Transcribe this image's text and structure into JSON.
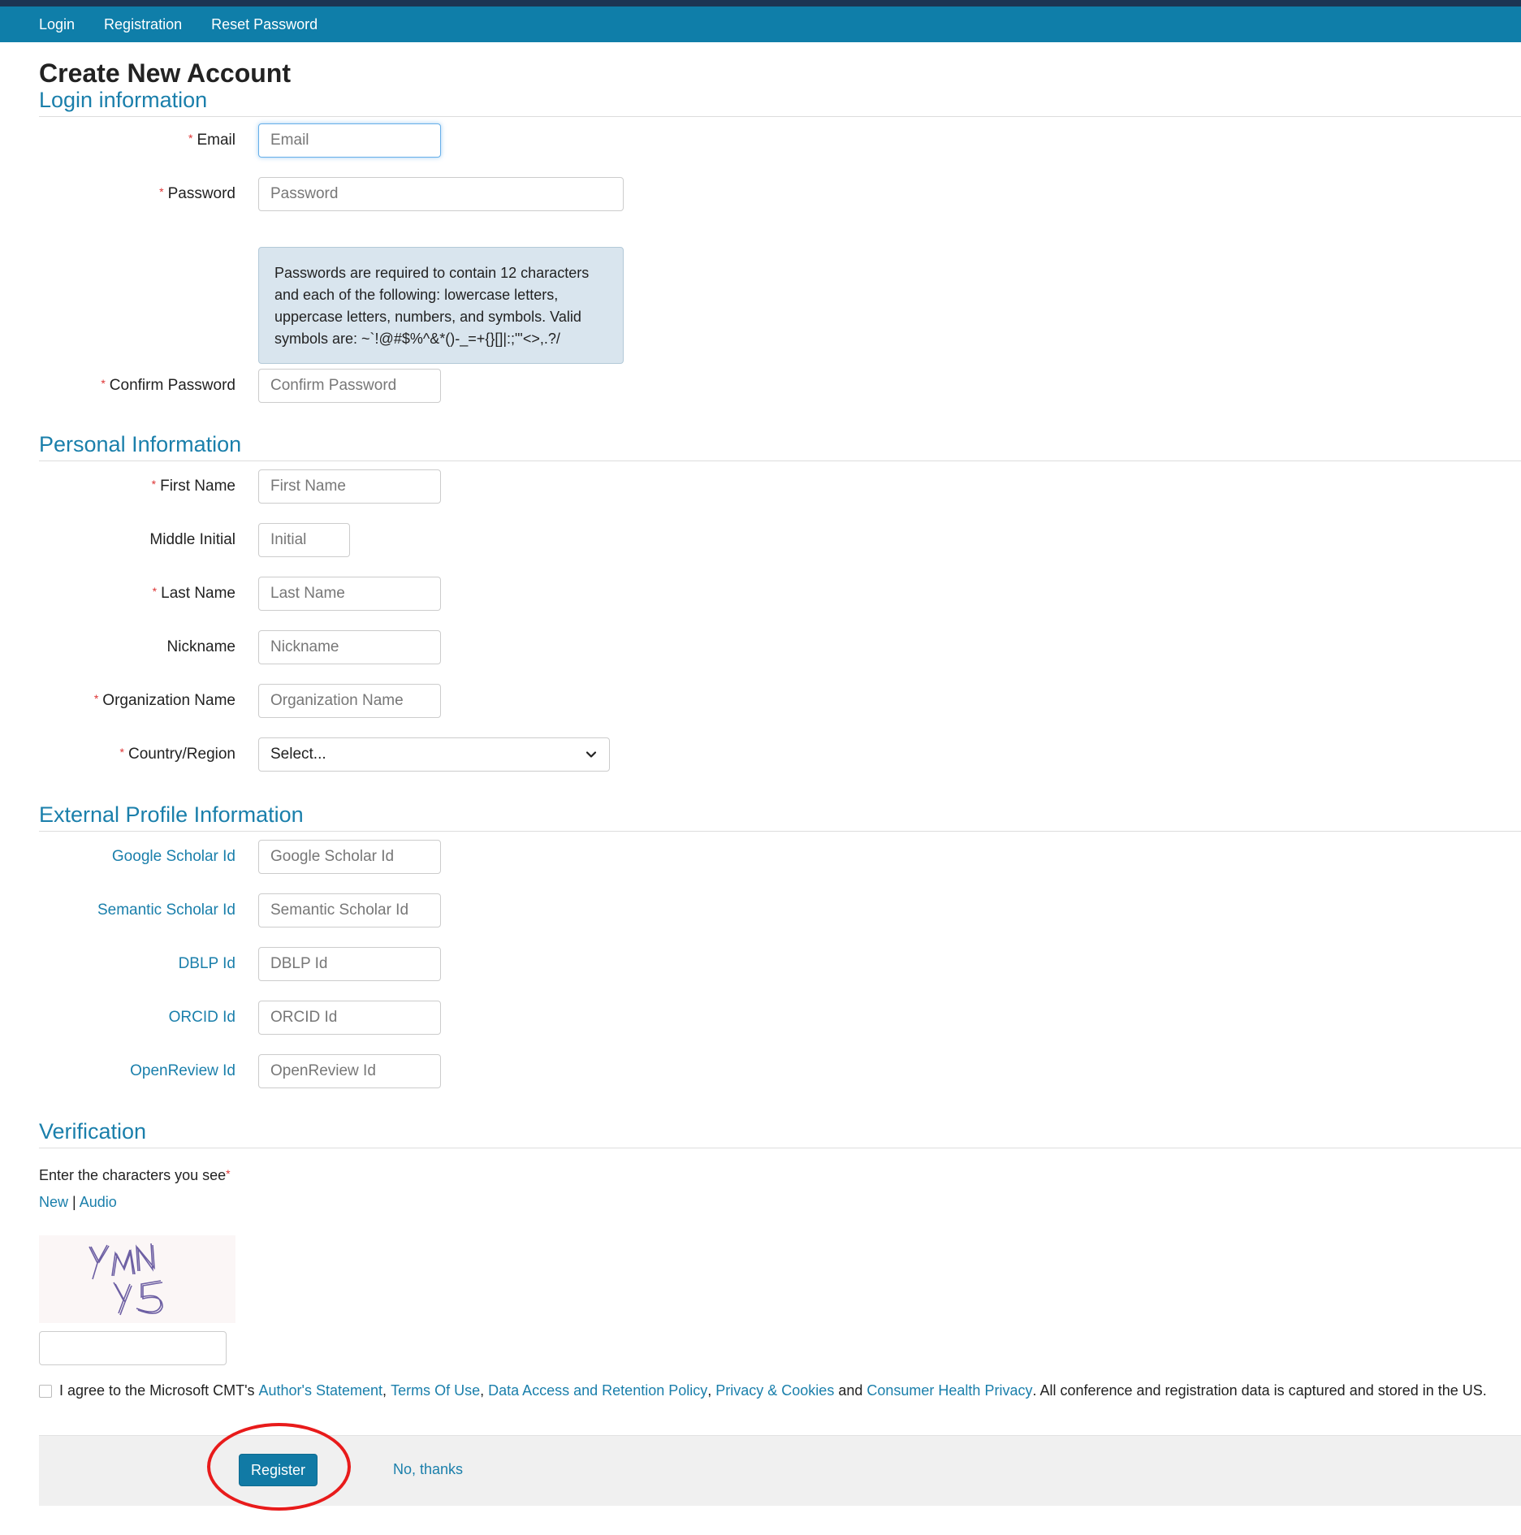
{
  "nav": {
    "login": "Login",
    "registration": "Registration",
    "reset_password": "Reset Password"
  },
  "page_title": "Create New Account",
  "sections": {
    "login": "Login information",
    "personal": "Personal Information",
    "external": "External Profile Information",
    "verification": "Verification"
  },
  "required_mark": "*",
  "fields": {
    "email": {
      "label": "Email",
      "placeholder": "Email"
    },
    "password": {
      "label": "Password",
      "placeholder": "Password"
    },
    "password_note": "Passwords are required to contain 12 characters and each of the following: lowercase letters, uppercase letters, numbers, and symbols. Valid symbols are: ~`!@#$%^&*()-_=+{}[]|:;\"'<>,.?/",
    "confirm_password": {
      "label": "Confirm Password",
      "placeholder": "Confirm Password"
    },
    "first_name": {
      "label": "First Name",
      "placeholder": "First Name"
    },
    "middle_initial": {
      "label": "Middle Initial",
      "placeholder": "Initial"
    },
    "last_name": {
      "label": "Last Name",
      "placeholder": "Last Name"
    },
    "nickname": {
      "label": "Nickname",
      "placeholder": "Nickname"
    },
    "organization": {
      "label": "Organization Name",
      "placeholder": "Organization Name"
    },
    "country": {
      "label": "Country/Region",
      "value": "Select..."
    },
    "google_scholar": {
      "label": "Google Scholar Id",
      "placeholder": "Google Scholar Id"
    },
    "semantic_scholar": {
      "label": "Semantic Scholar Id",
      "placeholder": "Semantic Scholar Id"
    },
    "dblp": {
      "label": "DBLP Id",
      "placeholder": "DBLP Id"
    },
    "orcid": {
      "label": "ORCID Id",
      "placeholder": "ORCID Id"
    },
    "openreview": {
      "label": "OpenReview Id",
      "placeholder": "OpenReview Id"
    }
  },
  "verification": {
    "prompt": "Enter the characters you see",
    "new_link": "New",
    "separator": "|",
    "audio_link": "Audio",
    "captcha_text": "YMN y5"
  },
  "agreement": {
    "prefix": "I agree to the Microsoft CMT's ",
    "authors_statement": "Author's Statement",
    "comma1": ", ",
    "terms": "Terms Of Use",
    "comma2": ", ",
    "data_policy": "Data Access and Retention Policy",
    "comma3": ", ",
    "privacy": "Privacy & Cookies",
    "and": " and ",
    "health": "Consumer Health Privacy",
    "suffix": ". All conference and registration data is captured and stored in the US."
  },
  "buttons": {
    "register": "Register",
    "no_thanks": "No, thanks"
  },
  "colors": {
    "navbar": "#0f7ea9",
    "accent": "#1a7fab",
    "required": "#d33333",
    "highlight_circle": "#e81b1b"
  }
}
